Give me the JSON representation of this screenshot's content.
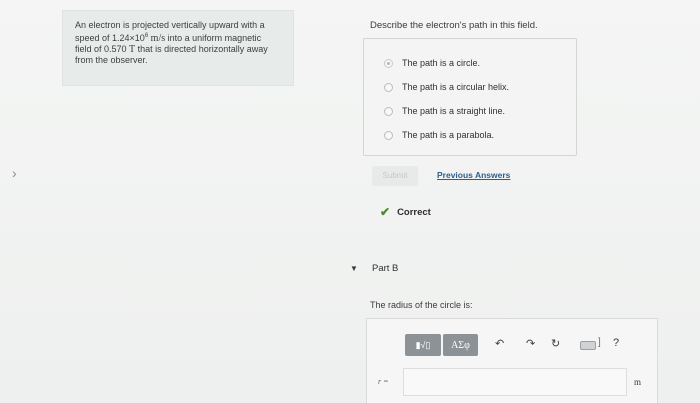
{
  "problem": {
    "line1": "An electron is projected vertically upward with a",
    "line2_pre": "speed of 1.24×10",
    "line2_exp": "6",
    "line2_unit": "m/s",
    "line2_post": " into a uniform magnetic",
    "line3_pre": "field of 0.570 ",
    "line3_unit": "T",
    "line3_post": " that is directed horizontally away",
    "line4": "from the observer."
  },
  "nav": {
    "next_icon": "chevron-right-icon",
    "glyph": "›"
  },
  "part_a": {
    "question": "Describe the electron's path in this field.",
    "choices": [
      {
        "label": "The path is a circle.",
        "selected": true
      },
      {
        "label": "The path is a circular helix.",
        "selected": false
      },
      {
        "label": "The path is a straight line.",
        "selected": false
      },
      {
        "label": "The path is a parabola.",
        "selected": false
      }
    ],
    "submit_label": "Submit",
    "previous_answers_label": "Previous Answers",
    "feedback": "Correct",
    "feedback_icon": "checkmark-icon",
    "feedback_color": "#4c8a2a"
  },
  "part_b": {
    "caret": "▼",
    "label": "Part B",
    "question": "The radius of the circle is:",
    "toolbar": {
      "math_label": "▮√▯",
      "greek_label": "ΑΣφ",
      "undo_glyph": "↶",
      "redo_glyph": "↷",
      "reset_glyph": "↻",
      "keyboard_bracket": "]",
      "help_glyph": "?"
    },
    "input_label": "r =",
    "input_value": "",
    "unit": "m"
  }
}
